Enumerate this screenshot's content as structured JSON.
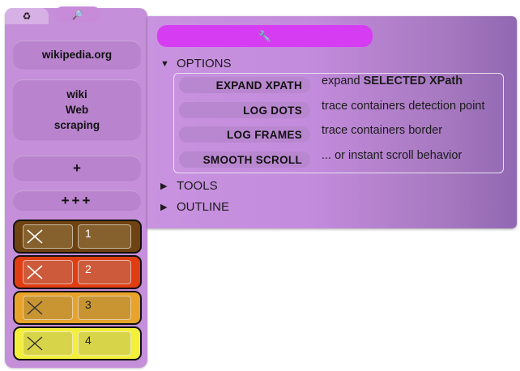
{
  "sidebar": {
    "tabs": [
      {
        "icon": "recycle-icon",
        "glyph": "♻"
      },
      {
        "icon": "search-icon",
        "glyph": "🔎"
      }
    ],
    "site_label": "wikipedia.org",
    "project_lines": [
      "wiki",
      "Web",
      "scraping"
    ],
    "add_label": "+",
    "add_many_label": "+++",
    "slots": [
      {
        "number": "1",
        "color": "#6e4311",
        "cell_color": "#86602d"
      },
      {
        "number": "2",
        "color": "#e03d12",
        "cell_color": "#cd5a3a"
      },
      {
        "number": "3",
        "color": "#e8a42a",
        "cell_color": "#c99533"
      },
      {
        "number": "4",
        "color": "#f3ef3a",
        "cell_color": "#d8d44a"
      }
    ]
  },
  "panel": {
    "header_icon": "wrench-icon",
    "header_glyph": "🔧",
    "accent_color": "#d63cf2",
    "sections": {
      "options": {
        "label": "OPTIONS",
        "expanded": true,
        "marker": "▼"
      },
      "tools": {
        "label": "TOOLS",
        "expanded": false,
        "marker": "▶"
      },
      "outline": {
        "label": "OUTLINE",
        "expanded": false,
        "marker": "▶"
      }
    },
    "options": [
      {
        "button": "EXPAND XPATH",
        "desc_prefix": "expand ",
        "desc_bold": "SELECTED XPath"
      },
      {
        "button": "LOG DOTS",
        "desc_prefix": "trace containers detection point",
        "desc_bold": ""
      },
      {
        "button": "LOG FRAMES",
        "desc_prefix": "trace containers border",
        "desc_bold": ""
      },
      {
        "button": "SMOOTH SCROLL",
        "desc_prefix": "... or instant scroll behavior",
        "desc_bold": ""
      }
    ]
  }
}
